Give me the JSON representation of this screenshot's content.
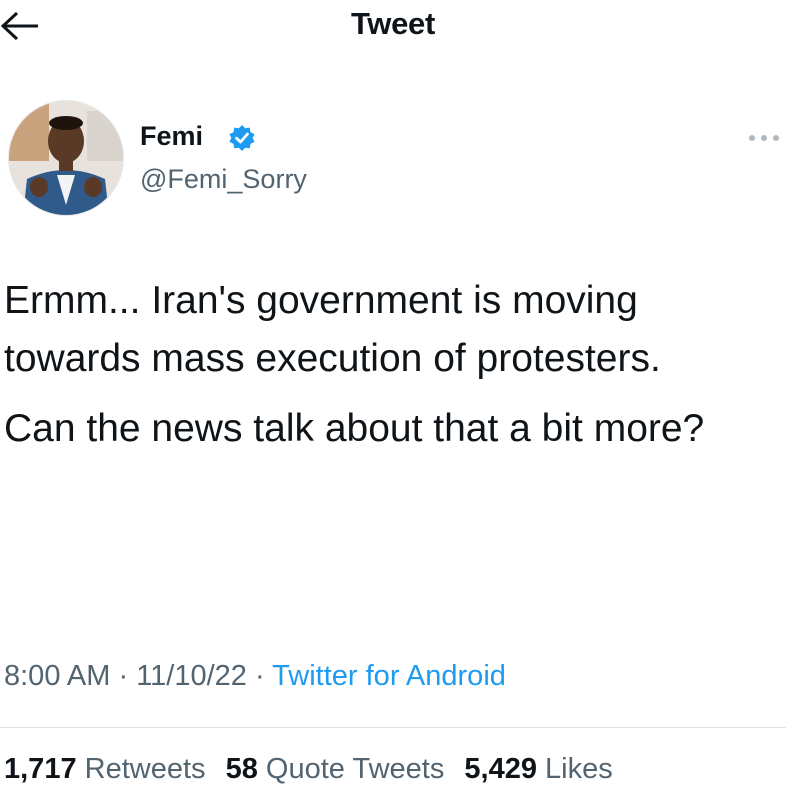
{
  "header": {
    "title": "Tweet",
    "back_icon": "back-arrow-icon"
  },
  "author": {
    "name": "Femi",
    "handle": "@Femi_Sorry",
    "verified": true,
    "verified_icon": "verified-badge-icon",
    "avatar_icon": "avatar-photo"
  },
  "more_icon": "more-options-icon",
  "tweet": {
    "paragraphs": [
      "Ermm... Iran's government is moving towards mass execution of protesters.",
      "Can the news talk about that a bit more?"
    ]
  },
  "meta": {
    "time": "8:00 AM",
    "separator1": " · ",
    "date": "11/10/22",
    "separator2": " · ",
    "source": "Twitter for Android"
  },
  "stats": {
    "retweets_count": "1,717",
    "retweets_label": "Retweets",
    "quotes_count": "58",
    "quotes_label": "Quote Tweets",
    "likes_count": "5,429",
    "likes_label": "Likes"
  },
  "colors": {
    "link": "#1d9bf0",
    "secondary_text": "#536471",
    "primary_text": "#0f1419",
    "verified": "#1d9bf0"
  }
}
